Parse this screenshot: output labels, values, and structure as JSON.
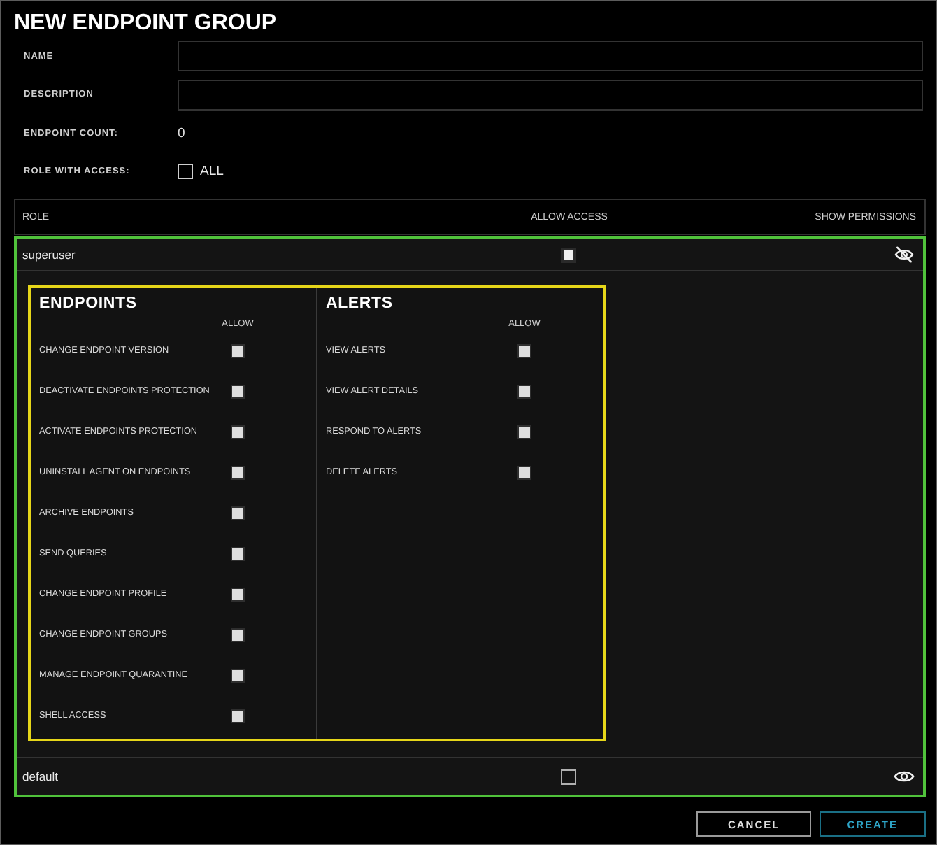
{
  "title": "NEW ENDPOINT GROUP",
  "form": {
    "fields": [
      {
        "kind": "input",
        "label": "NAME"
      },
      {
        "kind": "input",
        "label": "DESCRIPTION"
      },
      {
        "kind": "value",
        "label": "ENDPOINT COUNT:",
        "value": "0"
      },
      {
        "kind": "checkbox",
        "label": "ROLE WITH ACCESS:",
        "option": "ALL",
        "checked": false
      }
    ]
  },
  "roles_table": {
    "columns": [
      "ROLE",
      "ALLOW ACCESS",
      "SHOW PERMISSIONS"
    ],
    "rows": [
      {
        "role": "superuser",
        "allow_access": true,
        "expanded": true,
        "permission_groups": [
          {
            "title": "ENDPOINTS",
            "column_label": "ALLOW",
            "items": [
              {
                "label": "CHANGE ENDPOINT VERSION",
                "checked": true
              },
              {
                "label": "DEACTIVATE ENDPOINTS PROTECTION",
                "checked": true
              },
              {
                "label": "ACTIVATE ENDPOINTS PROTECTION",
                "checked": true
              },
              {
                "label": "UNINSTALL AGENT ON ENDPOINTS",
                "checked": true
              },
              {
                "label": "ARCHIVE ENDPOINTS",
                "checked": true
              },
              {
                "label": "SEND QUERIES",
                "checked": true
              },
              {
                "label": "CHANGE ENDPOINT PROFILE",
                "checked": true
              },
              {
                "label": "CHANGE ENDPOINT GROUPS",
                "checked": true
              },
              {
                "label": "MANAGE ENDPOINT QUARANTINE",
                "checked": true
              },
              {
                "label": "SHELL ACCESS",
                "checked": true
              }
            ]
          },
          {
            "title": "ALERTS",
            "column_label": "ALLOW",
            "items": [
              {
                "label": "VIEW ALERTS",
                "checked": true
              },
              {
                "label": "VIEW ALERT DETAILS",
                "checked": true
              },
              {
                "label": "RESPOND TO ALERTS",
                "checked": true
              },
              {
                "label": "DELETE ALERTS",
                "checked": true
              }
            ]
          }
        ]
      },
      {
        "role": "default",
        "allow_access": false,
        "expanded": false
      }
    ]
  },
  "buttons": [
    {
      "kind": "cancel",
      "label": "CANCEL"
    },
    {
      "kind": "create",
      "label": "CREATE"
    }
  ]
}
